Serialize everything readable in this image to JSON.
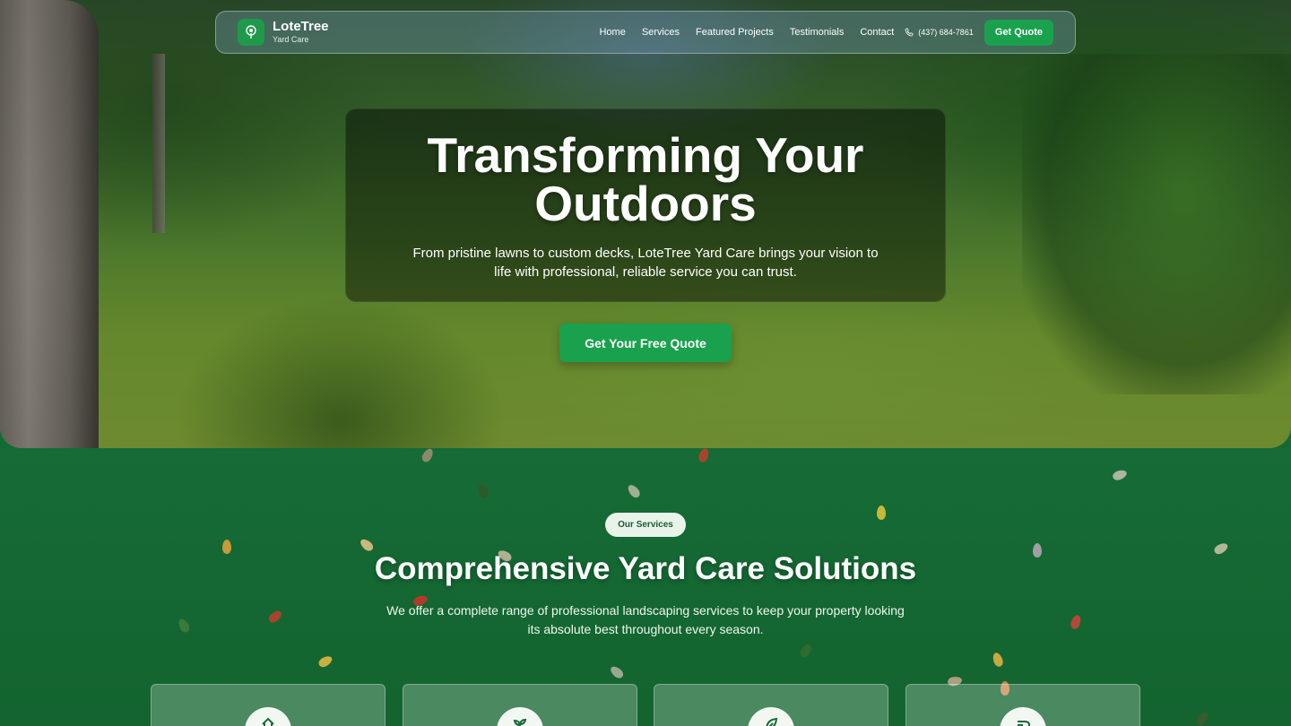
{
  "nav": {
    "brand_name": "LoteTree",
    "brand_sub": "Yard Care",
    "links": [
      "Home",
      "Services",
      "Featured Projects",
      "Testimonials",
      "Contact"
    ],
    "phone": "(437) 684-7861",
    "cta": "Get Quote"
  },
  "hero": {
    "title": "Transforming Your Outdoors",
    "subtitle": "From pristine lawns to custom decks, LoteTree Yard Care brings your vision to life with professional, reliable service you can trust.",
    "cta": "Get Your Free Quote"
  },
  "services": {
    "badge": "Our Services",
    "title": "Comprehensive Yard Care Solutions",
    "subtitle": "We offer a complete range of professional landscaping services to keep your property looking its absolute best throughout every season.",
    "cards": [
      {
        "icon": "home-icon"
      },
      {
        "icon": "sprout-icon"
      },
      {
        "icon": "leaf-icon"
      },
      {
        "icon": "shovel-icon"
      }
    ]
  },
  "colors": {
    "accent_green": "#1aa14e",
    "section_green": "#166b36"
  }
}
